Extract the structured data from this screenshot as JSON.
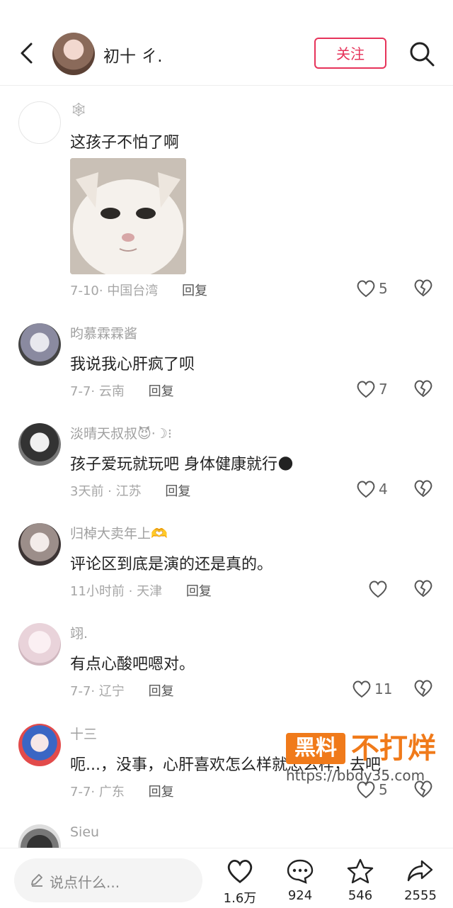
{
  "header": {
    "user_name": "初十 ㄔ.",
    "follow_label": "关注"
  },
  "comments": [
    {
      "name": "🕸",
      "text": "这孩子不怕了啊",
      "date": "7-10",
      "location": "中国台湾",
      "reply": "回复",
      "likes": "5"
    },
    {
      "name": "昀慕霖霖酱",
      "text": "我说我心肝疯了呗",
      "date": "7-7",
      "location": "云南",
      "reply": "回复",
      "likes": "7"
    },
    {
      "name": "淡晴天叔叔😈·☽⁝",
      "text": "孩子爱玩就玩吧 身体健康就行🌑",
      "date": "3天前",
      "location": "江苏",
      "reply": "回复",
      "likes": "4"
    },
    {
      "name": "归棹大卖年上🫶",
      "text": "评论区到底是演的还是真的。",
      "date": "11小时前",
      "location": "天津",
      "reply": "回复",
      "likes": ""
    },
    {
      "name": "翊.",
      "text": "有点心酸吧嗯对。",
      "date": "7-7",
      "location": "辽宁",
      "reply": "回复",
      "likes": "11"
    },
    {
      "name": "十三",
      "text": "呃...，没事，心肝喜欢怎么样就怎么样，去吧",
      "date": "7-7",
      "location": "广东",
      "reply": "回复",
      "likes": "5"
    },
    {
      "name": "Sieu"
    }
  ],
  "watermark": {
    "box": "黑料",
    "title": "不打烊",
    "url": "https://bbdy35.com"
  },
  "bottom_bar": {
    "placeholder": "说点什么...",
    "like_count": "1.6万",
    "comment_count": "924",
    "star_count": "546",
    "share_count": "2555"
  },
  "colors": {
    "accent": "#e6335a",
    "watermark": "#f07a1a"
  }
}
